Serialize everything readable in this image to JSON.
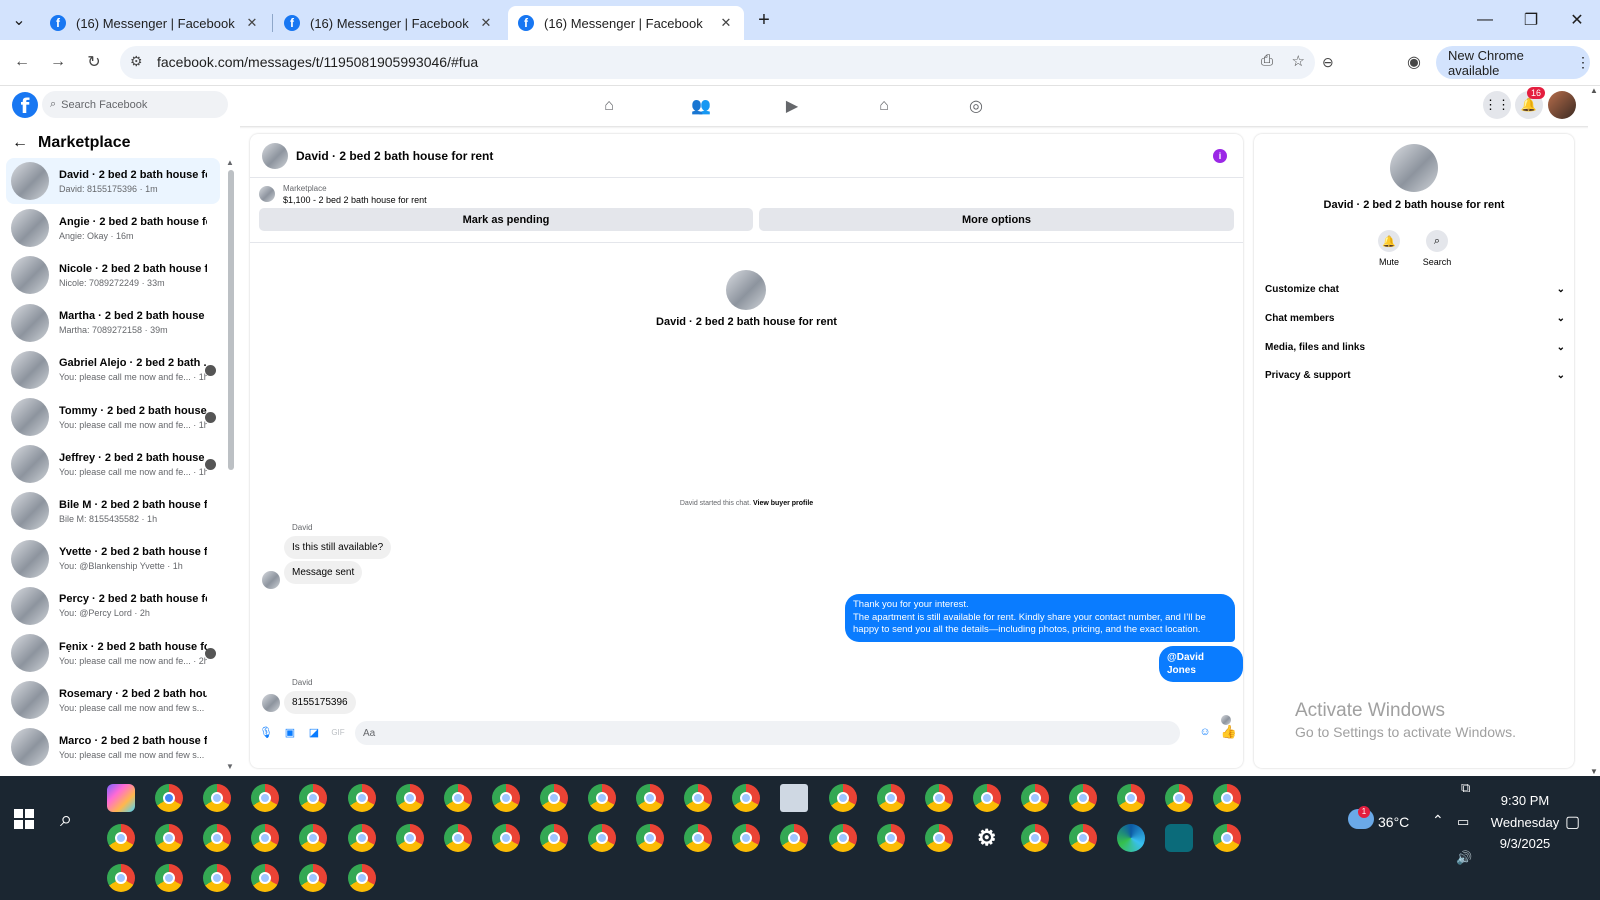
{
  "browser": {
    "tabs": [
      {
        "title": "(16) Messenger | Facebook"
      },
      {
        "title": "(16) Messenger | Facebook"
      },
      {
        "title": "(16) Messenger | Facebook"
      }
    ],
    "url": "facebook.com/messages/t/1195081905993046/#fua",
    "new_chrome_label": "New Chrome available"
  },
  "fb": {
    "search_placeholder": "Search Facebook",
    "notification_count": "16"
  },
  "left_panel": {
    "title": "Marketplace",
    "conversations": [
      {
        "name": "David · 2 bed 2 bath house for ...",
        "preview": "David: 8155175396 · 1m"
      },
      {
        "name": "Angie · 2 bed 2 bath house for ...",
        "preview": "Angie: Okay · 16m"
      },
      {
        "name": "Nicole · 2 bed 2 bath house for...",
        "preview": "Nicole: 7089272249 · 33m"
      },
      {
        "name": "Martha · 2 bed 2 bath house fo...",
        "preview": "Martha: 7089272158 · 39m"
      },
      {
        "name": "Gabriel Alejo · 2 bed 2 bath ...",
        "preview": "You: please call me now and fe... · 1h"
      },
      {
        "name": "Tommy · 2 bed 2 bath house ...",
        "preview": "You: please call me now and fe... · 1h"
      },
      {
        "name": "Jeffrey · 2 bed 2 bath house f...",
        "preview": "You: please call me now and fe... · 1h"
      },
      {
        "name": "Bile M · 2 bed 2 bath house for...",
        "preview": "Bile M: 8155435582 · 1h"
      },
      {
        "name": "Yvette · 2 bed 2 bath house for...",
        "preview": "You: @Blankenship Yvette · 1h"
      },
      {
        "name": "Percy · 2 bed 2 bath house for r...",
        "preview": "You: @Percy Lord · 2h"
      },
      {
        "name": "Fẹnix · 2 bed 2 bath house fo...",
        "preview": "You: please call me now and fe... · 2h"
      },
      {
        "name": "Rosemary · 2 bed 2 bath house...",
        "preview": "You: please call me now and few s... · 2h"
      },
      {
        "name": "Marco · 2 bed 2 bath house for...",
        "preview": "You: please call me now and few s... · 2h"
      }
    ]
  },
  "chat": {
    "header_title": "David · 2 bed 2 bath house for rent",
    "listing_source": "Marketplace",
    "listing_title": "$1,100 - 2 bed 2 bath house for rent",
    "mark_pending_label": "Mark as pending",
    "more_options_label": "More options",
    "intro_name": "David · 2 bed 2 bath house for rent",
    "started_text": "David started this chat.",
    "view_profile_label": "View buyer profile",
    "sender1": "David",
    "msg1": "Is this still available?",
    "msg2": "Message sent",
    "out_msg": "Thank you for your interest.\nThe apartment is still available for rent. Kindly share your contact number, and I’ll be happy to send you all the details—including photos, pricing, and the exact location.",
    "out_mention": "@David Jones",
    "sender2": "David",
    "msg3": "8155175396",
    "composer_placeholder": "Aa"
  },
  "right_panel": {
    "name": "David · 2 bed 2 bath house for rent",
    "mute_label": "Mute",
    "search_label": "Search",
    "sections": [
      "Customize chat",
      "Chat members",
      "Media, files and links",
      "Privacy & support"
    ]
  },
  "watermark": {
    "line1": "Activate Windows",
    "line2": "Go to Settings to activate Windows."
  },
  "taskbar": {
    "temperature": "36°C",
    "time": "9:30 PM",
    "day": "Wednesday",
    "date": "9/3/2025",
    "weather_badge": "1"
  }
}
